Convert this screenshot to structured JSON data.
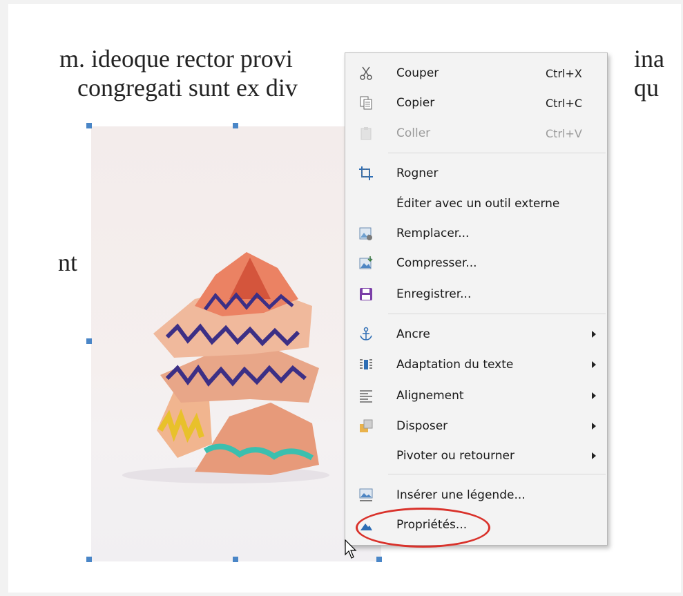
{
  "document": {
    "line1": "m. ideoque rector provi",
    "line1_end": "ina",
    "line2": "congregati sunt ex div",
    "line2_end": "qu",
    "stray_text": "nt"
  },
  "context_menu": {
    "items": [
      {
        "label": "Couper",
        "shortcut": "Ctrl+X",
        "icon": "scissors-icon",
        "disabled": false
      },
      {
        "label": "Copier",
        "shortcut": "Ctrl+C",
        "icon": "copy-icon",
        "disabled": false
      },
      {
        "label": "Coller",
        "shortcut": "Ctrl+V",
        "icon": "paste-icon",
        "disabled": true
      },
      {
        "label": "Rogner",
        "icon": "crop-icon"
      },
      {
        "label": "Éditer avec un outil externe"
      },
      {
        "label": "Remplacer...",
        "icon": "replace-image-icon"
      },
      {
        "label": "Compresser...",
        "icon": "compress-image-icon"
      },
      {
        "label": "Enregistrer...",
        "icon": "save-icon"
      },
      {
        "label": "Ancre",
        "icon": "anchor-icon",
        "submenu": true
      },
      {
        "label": "Adaptation du texte",
        "icon": "text-wrap-icon",
        "submenu": true
      },
      {
        "label": "Alignement",
        "icon": "align-icon",
        "submenu": true
      },
      {
        "label": "Disposer",
        "icon": "arrange-icon",
        "submenu": true
      },
      {
        "label": "Pivoter ou retourner",
        "submenu": true
      },
      {
        "label": "Insérer une légende...",
        "icon": "caption-icon"
      },
      {
        "label": "Propriétés...",
        "icon": "properties-icon",
        "highlighted_by_circle": true
      }
    ]
  },
  "colors": {
    "handle": "#4a86c7",
    "annotation_circle": "#d9322b",
    "menu_bg": "#f3f3f3"
  }
}
